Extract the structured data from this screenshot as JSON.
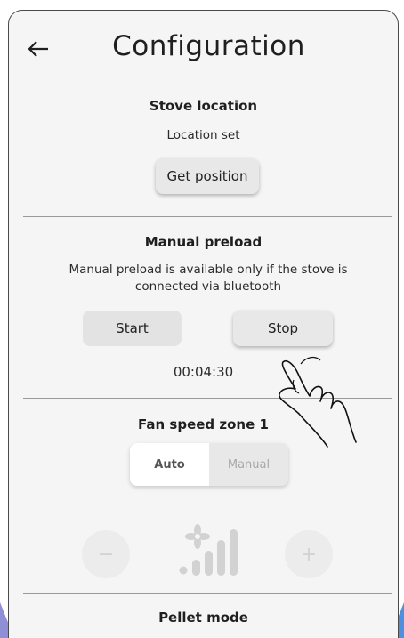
{
  "header": {
    "title": "Configuration",
    "back_icon": "arrow-left-icon"
  },
  "stove_location": {
    "title": "Stove location",
    "status": "Location set",
    "get_position_label": "Get position"
  },
  "manual_preload": {
    "title": "Manual preload",
    "description": "Manual preload is available only if the stove is connected via bluetooth",
    "start_label": "Start",
    "stop_label": "Stop",
    "timer": "00:04:30"
  },
  "fan_speed": {
    "title": "Fan speed zone 1",
    "mode_options": [
      "Auto",
      "Manual"
    ],
    "selected_mode": "Auto",
    "decrease_label": "−",
    "increase_label": "+",
    "fan_icon": "fan-speed-icon"
  },
  "pellet_mode": {
    "title": "Pellet mode"
  },
  "overlay": {
    "hand_icon": "tap-hand-icon"
  },
  "colors": {
    "background": "#f5f5f5",
    "button": "#e3e3e3",
    "disabled": "#d2d2d2",
    "frame_left": "#8f8fd6",
    "frame_right": "#4e8fe0"
  }
}
